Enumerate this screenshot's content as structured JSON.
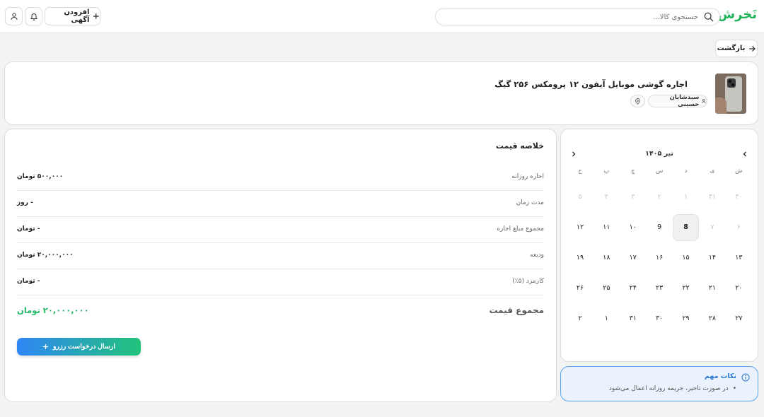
{
  "header": {
    "logo": "نَخرش",
    "search_placeholder": "جستجوی کالا...",
    "add_ad_label": "افزودن آگهی"
  },
  "back_label": "بازگشت",
  "product": {
    "title": "اجاره گوشی موبایل آیفون ۱۲ پرومکس ۲۵۶ گیگ",
    "owner": "سیدشایان حسینی"
  },
  "price_summary": {
    "title": "خلاصه قیمت",
    "rows": [
      {
        "label": "اجاره روزانه",
        "value": "۵۰۰,۰۰۰ تومان"
      },
      {
        "label": "مدت زمان",
        "value": "- روز"
      },
      {
        "label": "مجموع مبلغ اجاره",
        "value": "- تومان"
      },
      {
        "label": "ودیعه",
        "value": "۲۰,۰۰۰,۰۰۰ تومان"
      },
      {
        "label": "کارمزد (۵٪)",
        "value": "- تومان"
      }
    ],
    "total_label": "مجموع قیمت",
    "total_value": "۲۰,۰۰۰,۰۰۰ تومان",
    "submit_label": "ارسال درخواست رزرو"
  },
  "calendar": {
    "month": "تیر ۱۴۰۵",
    "weekdays": [
      "ش",
      "ی",
      "د",
      "س",
      "چ",
      "پ",
      "ج"
    ],
    "weeks": [
      [
        "۳۰",
        "۳۱",
        "۱",
        "۲",
        "۳",
        "۴",
        "۵"
      ],
      [
        "۶",
        "۷",
        "8",
        "9",
        "۱۰",
        "۱۱",
        "۱۲"
      ],
      [
        "۱۳",
        "۱۴",
        "۱۵",
        "۱۶",
        "۱۷",
        "۱۸",
        "۱۹"
      ],
      [
        "۲۰",
        "۲۱",
        "۲۲",
        "۲۳",
        "۲۴",
        "۲۵",
        "۲۶"
      ],
      [
        "۲۷",
        "۲۸",
        "۲۹",
        "۳۰",
        "۳۱",
        "۱",
        "۲"
      ]
    ],
    "past_count": 9,
    "today_index": 9
  },
  "notes": {
    "title": "نکات مهم",
    "items": [
      "در صورت تاخیر، جریمه روزانه اعمال می‌شود"
    ]
  },
  "colors": {
    "brand": "#1fb35a",
    "total": "#22b866",
    "note_accent": "#2b78d6",
    "gradient_start": "#2f86f5",
    "gradient_end": "#22c37a"
  }
}
